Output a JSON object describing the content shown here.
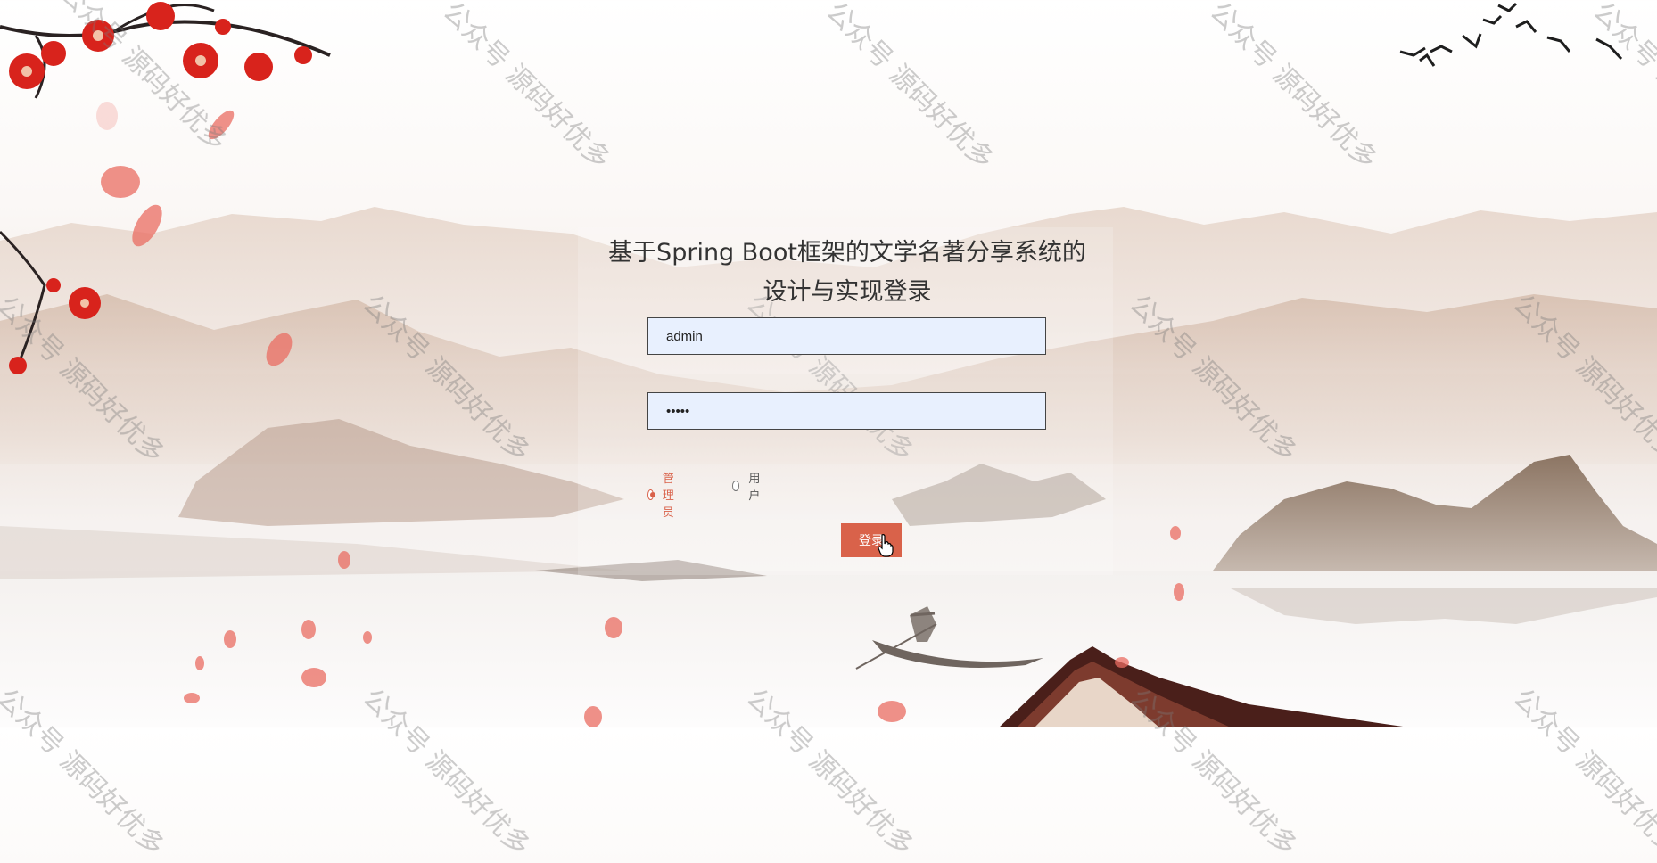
{
  "title": {
    "line1": "基于Spring Boot框架的文学名著分享系统的",
    "line2": "设计与实现登录"
  },
  "form": {
    "username_value": "admin",
    "password_value": "•••••"
  },
  "roles": {
    "admin_label": "管理员",
    "user_label": "用户",
    "selected": "管理员"
  },
  "login_button": "登录",
  "watermark_text": "公众号 源码好优多",
  "colors": {
    "accent": "#d9624a",
    "input_bg": "#e8f0fe",
    "title_text": "#333333"
  },
  "icons": [
    "plum-blossom-branch",
    "flying-birds",
    "petals",
    "boat-icon",
    "pagoda-roof",
    "hand-pointer-cursor"
  ]
}
